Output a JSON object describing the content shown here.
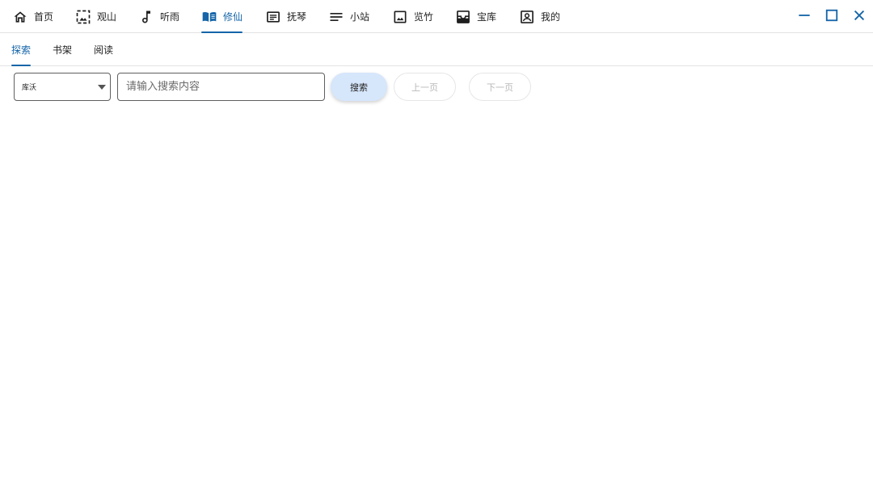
{
  "nav": {
    "items": [
      {
        "label": "首页",
        "icon": "home-icon"
      },
      {
        "label": "观山",
        "icon": "landscape-frame-icon"
      },
      {
        "label": "听雨",
        "icon": "music-note-icon"
      },
      {
        "label": "修仙",
        "icon": "book-open-icon",
        "active": true
      },
      {
        "label": "抚琴",
        "icon": "article-icon"
      },
      {
        "label": "小站",
        "icon": "notes-icon"
      },
      {
        "label": "览竹",
        "icon": "image-icon"
      },
      {
        "label": "宝库",
        "icon": "inbox-tray-icon"
      },
      {
        "label": "我的",
        "icon": "account-box-icon"
      }
    ],
    "accent": "#1565a8"
  },
  "subtabs": {
    "items": [
      {
        "label": "探索",
        "active": true
      },
      {
        "label": "书架"
      },
      {
        "label": "阅读"
      }
    ]
  },
  "search": {
    "source_value": "库沃",
    "placeholder": "请输入搜索内容",
    "search_label": "搜索",
    "prev_label": "上一页",
    "next_label": "下一页"
  }
}
